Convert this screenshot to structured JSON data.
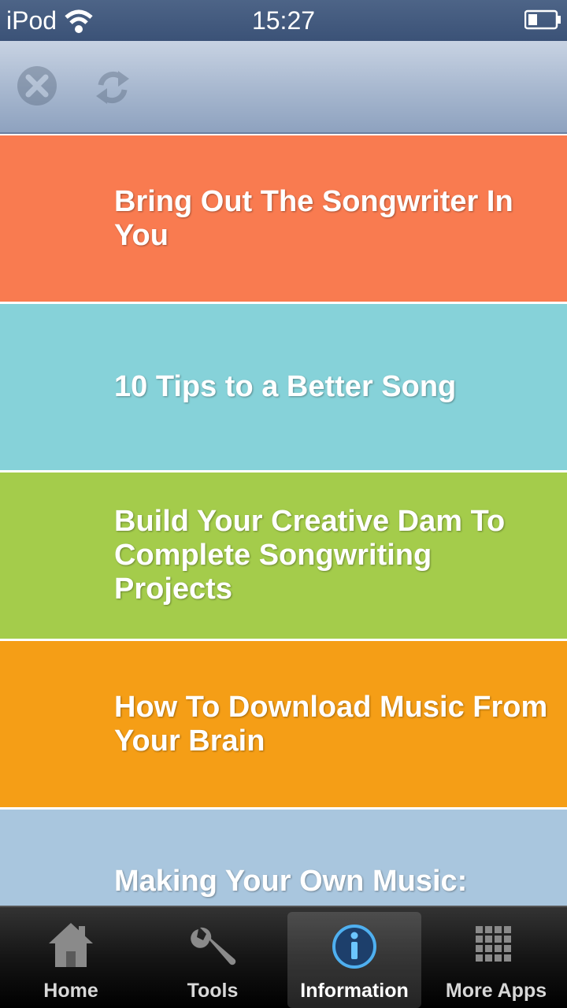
{
  "status": {
    "device": "iPod",
    "time": "15:27"
  },
  "toolbar": {
    "stop_icon": "stop-icon",
    "reload_icon": "reload-icon"
  },
  "articles": [
    {
      "title": "Bring Out The Songwriter In You",
      "color": "#f97b50"
    },
    {
      "title": "10 Tips to a Better Song",
      "color": "#86d2d9"
    },
    {
      "title": "Build Your Creative Dam To Complete Songwriting Projects",
      "color": "#a4cc4b"
    },
    {
      "title": "How To Download Music From Your Brain",
      "color": "#f59e16"
    },
    {
      "title": "Making Your Own Music:",
      "color": "#a9c6de"
    }
  ],
  "tabs": [
    {
      "label": "Home",
      "icon": "home-icon"
    },
    {
      "label": "Tools",
      "icon": "wrench-icon"
    },
    {
      "label": "Information",
      "icon": "info-icon",
      "active": true
    },
    {
      "label": "More Apps",
      "icon": "grid-icon"
    }
  ]
}
